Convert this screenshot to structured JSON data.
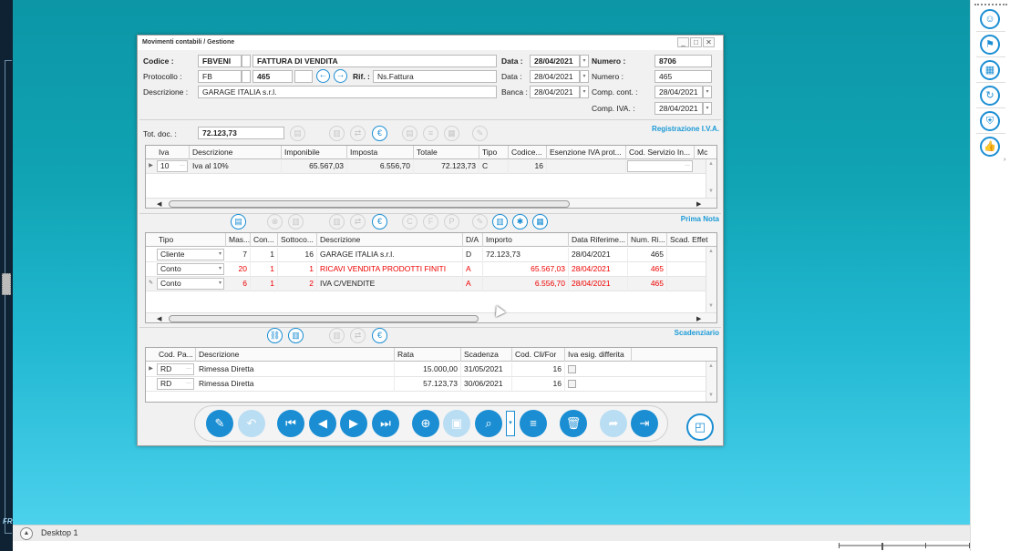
{
  "window": {
    "title": "Movimenti contabili / Gestione",
    "controls": {
      "minimize": "_",
      "maximize": "□",
      "close": "✕"
    }
  },
  "header": {
    "codice_label": "Codice :",
    "codice_value": "FBVENI",
    "codice_desc": "FATTURA DI VENDITA",
    "data_label": "Data :",
    "data_value": "28/04/2021",
    "numero_label": "Numero :",
    "numero_value": "8706",
    "protocollo_label": "Protocollo :",
    "protocollo_value": "FB",
    "protocollo_num": "465",
    "rif_label": "Rif. :",
    "rif_value": "Ns.Fattura",
    "data2_label": "Data :",
    "data2_value": "28/04/2021",
    "numero2_label": "Numero :",
    "numero2_value": "465",
    "descrizione_label": "Descrizione :",
    "descrizione_value": "GARAGE ITALIA s.r.l.",
    "banca_label": "Banca :",
    "banca_value": "28/04/2021",
    "comp_cont_label": "Comp. cont. :",
    "comp_cont_value": "28/04/2021",
    "comp_iva_label": "Comp. IVA. :",
    "comp_iva_value": "28/04/2021"
  },
  "iva_section": {
    "title": "Registrazione I.V.A.",
    "tot_doc_label": "Tot. doc. :",
    "tot_doc_value": "72.123,73",
    "headers": [
      "Iva",
      "Descrizione",
      "Imponibile",
      "Imposta",
      "Totale",
      "Tipo",
      "Codice...",
      "Esenzione IVA prot...",
      "Cod. Servizio In...",
      "Mc"
    ],
    "rows": [
      {
        "iva": "10",
        "descrizione": "Iva al 10%",
        "imponibile": "65.567,03",
        "imposta": "6.556,70",
        "totale": "72.123,73",
        "tipo": "C",
        "codice": "16",
        "esenzione": "",
        "cod_servizio": ""
      }
    ]
  },
  "prima_nota": {
    "title": "Prima Nota",
    "headers": [
      "Tipo",
      "Mas...",
      "Con...",
      "Sottoco...",
      "Descrizione",
      "D/A",
      "Importo",
      "Data Riferime...",
      "Num. Ri...",
      "Scad. Effet"
    ],
    "rows": [
      {
        "tipo": "Cliente",
        "mas": "7",
        "con": "1",
        "sotto": "16",
        "descrizione": "GARAGE ITALIA s.r.l.",
        "da": "D",
        "importo": "72.123,73",
        "data": "28/04/2021",
        "num": "465",
        "red": false
      },
      {
        "tipo": "Conto",
        "mas": "20",
        "con": "1",
        "sotto": "1",
        "descrizione": "RICAVI VENDITA PRODOTTI FINITI",
        "da": "A",
        "importo": "65.567,03",
        "data": "28/04/2021",
        "num": "465",
        "red": true
      },
      {
        "tipo": "Conto",
        "mas": "6",
        "con": "1",
        "sotto": "2",
        "descrizione": "IVA C/VENDITE",
        "da": "A",
        "importo": "6.556,70",
        "data": "28/04/2021",
        "num": "465",
        "red": true
      }
    ]
  },
  "scadenziario": {
    "title": "Scadenziario",
    "headers": [
      "Cod. Pa...",
      "Descrizione",
      "Rata",
      "Scadenza",
      "Cod. Cli/For",
      "Iva esig. differita"
    ],
    "rows": [
      {
        "cod": "RD",
        "descrizione": "Rimessa Diretta",
        "rata": "15.000,00",
        "scadenza": "31/05/2021",
        "codcli": "16"
      },
      {
        "cod": "RD",
        "descrizione": "Rimessa Diretta",
        "rata": "57.123,73",
        "scadenza": "30/06/2021",
        "codcli": "16"
      }
    ]
  },
  "taskbar": {
    "desktop_label": "Desktop 1"
  },
  "side_labels": {
    "fr": "FR"
  },
  "colors": {
    "accent": "#1b8ed3",
    "section_title": "#1b9ad6",
    "negative": "#e00000"
  }
}
